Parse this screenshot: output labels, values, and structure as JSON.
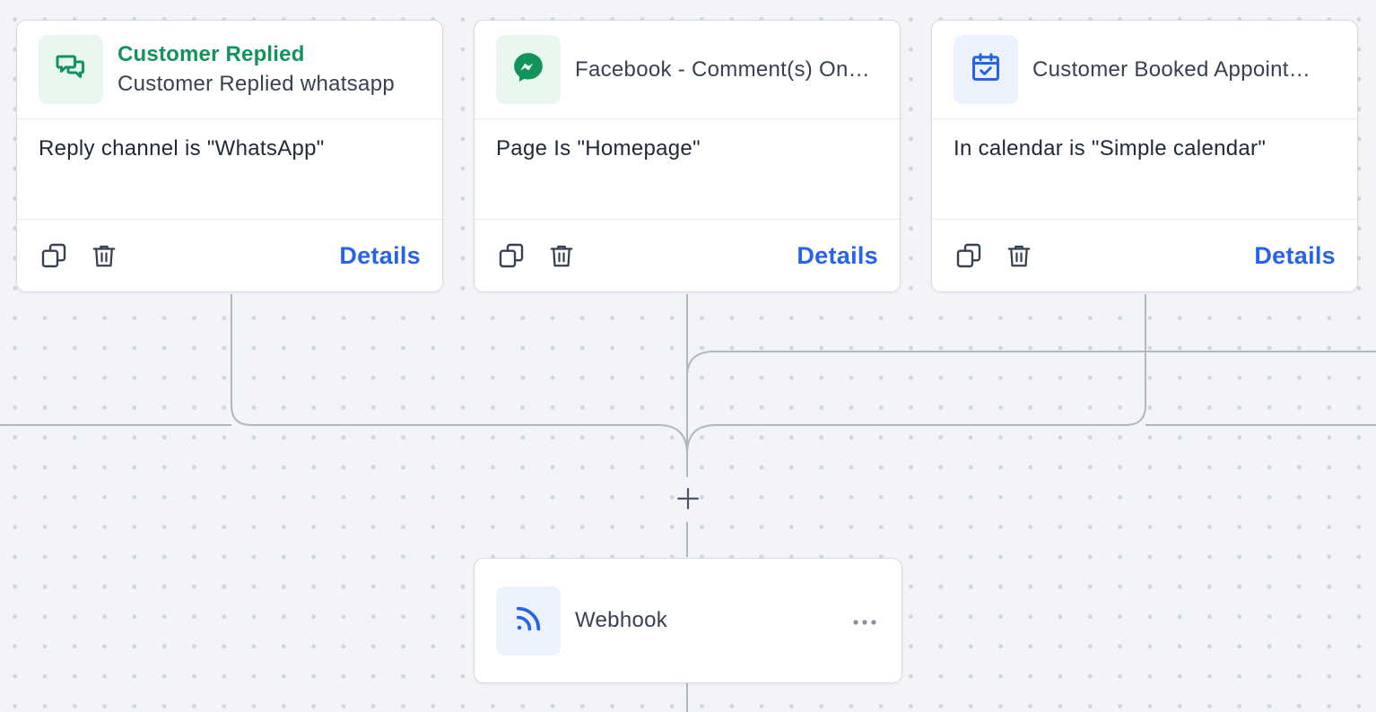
{
  "triggers": [
    {
      "title": "Customer Replied",
      "subtitle": "Customer Replied whatsapp",
      "icon": "chat-bubbles-icon",
      "icon_color": "#12935a",
      "condition": "Reply channel is \"WhatsApp\"",
      "details_label": "Details"
    },
    {
      "title": "",
      "subtitle": "Facebook - Comment(s) On…",
      "icon": "messenger-icon",
      "icon_color": "#12935a",
      "condition": "Page Is \"Homepage\"",
      "details_label": "Details"
    },
    {
      "title": "",
      "subtitle": "Customer Booked Appoint…",
      "icon": "calendar-check-icon",
      "icon_color": "#2563eb",
      "condition": "In calendar is \"Simple calendar\"",
      "details_label": "Details"
    }
  ],
  "action": {
    "title": "Webhook",
    "icon": "rss-icon",
    "icon_color": "#2563eb"
  },
  "colors": {
    "accent_green": "#12935a",
    "accent_blue": "#2563eb",
    "connector": "#b4b7be"
  }
}
